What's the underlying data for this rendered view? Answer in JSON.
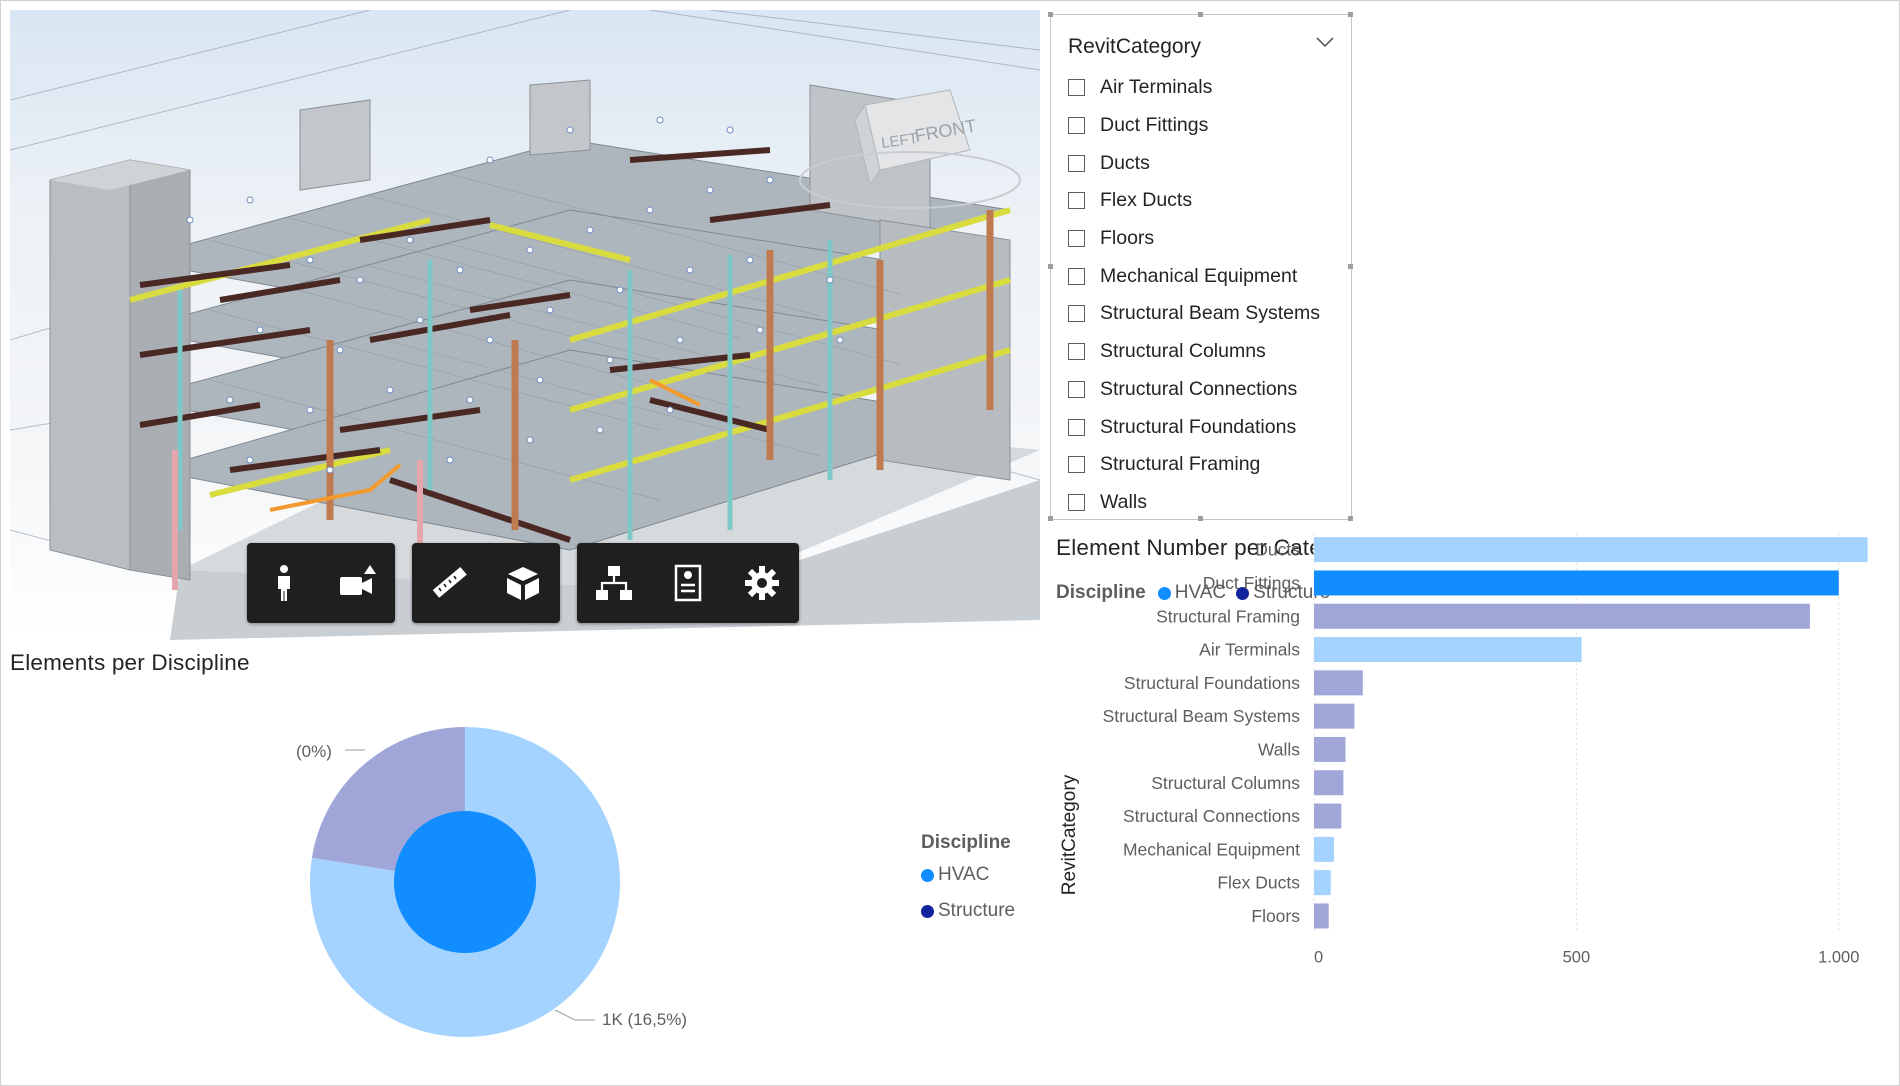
{
  "viewer": {
    "toolbar_groups": [
      [
        {
          "name": "person-icon",
          "label": "First person"
        },
        {
          "name": "camera-icon",
          "label": "Camera"
        }
      ],
      [
        {
          "name": "ruler-icon",
          "label": "Measure"
        },
        {
          "name": "cube-icon",
          "label": "Explode model"
        }
      ],
      [
        {
          "name": "hierarchy-icon",
          "label": "Model browser"
        },
        {
          "name": "properties-icon",
          "label": "Properties"
        },
        {
          "name": "gear-icon",
          "label": "Settings"
        }
      ]
    ],
    "viewcube": {
      "left": "LEFT",
      "front": "FRONT"
    }
  },
  "slicer": {
    "title": "RevitCategory",
    "items": [
      "Air Terminals",
      "Duct Fittings",
      "Ducts",
      "Flex Ducts",
      "Floors",
      "Mechanical Equipment",
      "Structural Beam Systems",
      "Structural Columns",
      "Structural Connections",
      "Structural Foundations",
      "Structural Framing",
      "Walls"
    ]
  },
  "donut": {
    "title": "Elements per Discipline",
    "legend_title": "Discipline",
    "legend": [
      {
        "name": "HVAC",
        "color": "#118dff"
      },
      {
        "name": "Structure",
        "color": "#12239e"
      }
    ],
    "label_small": "(0%)",
    "label_large": "1K (16,5%)",
    "chart_data": {
      "type": "pie",
      "note_rings": "outer ring = RevitCategory slices, inner ring = Discipline",
      "outer": [
        {
          "name": "HVAC-group",
          "value": 77.5,
          "color": "#a4d3ff"
        },
        {
          "name": "Structure-group",
          "value": 22.5,
          "color": "#a0a6d8"
        }
      ],
      "inner": [
        {
          "name": "HVAC",
          "value": 100,
          "color": "#118dff"
        }
      ]
    }
  },
  "bar": {
    "title": "Element Number per Category and Model",
    "legend_title": "Discipline",
    "legend": [
      {
        "name": "HVAC",
        "color": "#118dff"
      },
      {
        "name": "Structure",
        "color": "#12239e"
      }
    ],
    "y_axis_title": "RevitCategory",
    "chart_data": {
      "type": "bar",
      "orientation": "horizontal",
      "categories": [
        "Ducts",
        "Duct Fittings",
        "Structural Framing",
        "Air Terminals",
        "Structural Foundations",
        "Structural Beam Systems",
        "Walls",
        "Structural Columns",
        "Structural Connections",
        "Mechanical Equipment",
        "Flex Ducts",
        "Floors"
      ],
      "values": [
        1055,
        1000,
        945,
        510,
        93,
        77,
        60,
        56,
        52,
        38,
        32,
        28
      ],
      "colors": [
        "#a4d3ff",
        "#118dff",
        "#a0a6d8",
        "#a4d3ff",
        "#a0a6d8",
        "#a0a6d8",
        "#a0a6d8",
        "#a0a6d8",
        "#a0a6d8",
        "#a4d3ff",
        "#a4d3ff",
        "#a0a6d8"
      ],
      "xlim": [
        0,
        1050
      ],
      "ticks": [
        {
          "value": 0,
          "label": "0"
        },
        {
          "value": 500,
          "label": "500"
        },
        {
          "value": 1000,
          "label": "1.000"
        }
      ],
      "grid": true
    }
  }
}
